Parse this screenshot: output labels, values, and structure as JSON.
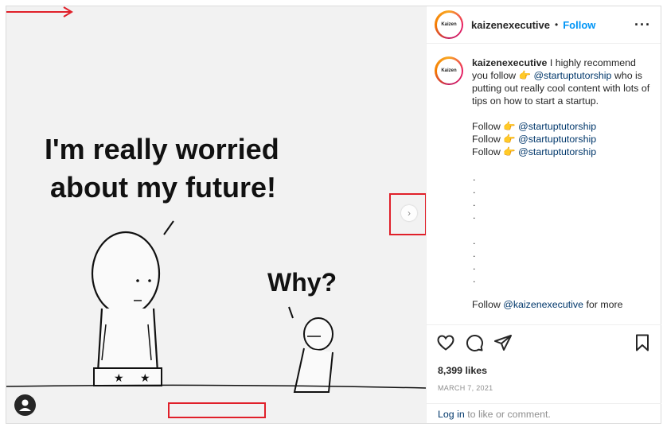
{
  "post": {
    "username": "kaizenexecutive",
    "separator": "•",
    "follow_label": "Follow",
    "more_icon": "···",
    "logo_text": "Kaizen",
    "image": {
      "speech_line1": "I'm really worried",
      "speech_line2": "about my future!",
      "reply": "Why?"
    },
    "next_icon": "›"
  },
  "caption": {
    "username": "kaizenexecutive",
    "intro": " I highly recommend you follow ",
    "hand": "👉",
    "mention": "@startuptutorship",
    "body": " who is putting out really cool content with lots of tips on how to start a startup.",
    "follow_word": "Follow ",
    "follow_lines": [
      "@startuptutorship",
      "@startuptutorship",
      "@startuptutorship"
    ],
    "dots": [
      ".",
      ".",
      ".",
      ".",
      ".",
      ".",
      ".",
      "."
    ],
    "last_follow": "Follow ",
    "last_mention": "@kaizenexecutive",
    "last_rest": " for more"
  },
  "actions": {
    "likes": "8,399 likes",
    "date": "MARCH 7, 2021",
    "login_link": "Log in",
    "login_rest": " to like or comment."
  },
  "colors": {
    "accent": "#0095f6",
    "annotation": "#e0202a"
  }
}
